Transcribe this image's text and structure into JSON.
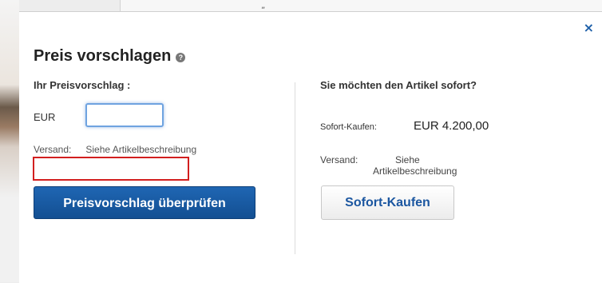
{
  "background": {
    "mark": "„"
  },
  "dialog": {
    "close_label": "×",
    "title": "Preis vorschlagen",
    "help_icon": "question-icon",
    "offer": {
      "heading": "Ihr Preisvorschlag :",
      "currency": "EUR",
      "input_value": "",
      "shipping_label": "Versand:",
      "shipping_value": "Siehe Artikelbeschreibung",
      "submit_label": "Preisvorschlag überprüfen"
    },
    "buy_now": {
      "heading": "Sie möchten den Artikel sofort?",
      "price_label": "Sofort-Kaufen:",
      "price_value": "EUR 4.200,00",
      "shipping_label": "Versand:",
      "shipping_value_line1": "Siehe",
      "shipping_value_line2": "Artikelbeschreibung",
      "button_label": "Sofort-Kaufen"
    }
  },
  "colors": {
    "primary_button": "#1a5ca5",
    "link_blue": "#1d5fa8",
    "error_border": "#d21f1f",
    "input_focus": "#6fa3e0"
  }
}
